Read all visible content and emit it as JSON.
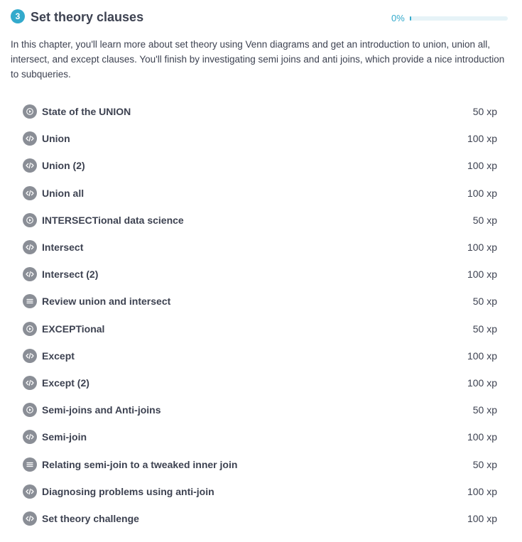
{
  "chapter": {
    "number": "3",
    "title": "Set theory clauses",
    "progress_label": "0%",
    "progress_value": 0,
    "accent_color": "#33aacc",
    "description": "In this chapter, you'll learn more about set theory using Venn diagrams and get an introduction to union, union all, intersect, and except clauses. You'll finish by investigating semi joins and anti joins, which provide a nice introduction to subqueries."
  },
  "lessons": [
    {
      "icon": "play-icon",
      "title": "State of the UNION",
      "xp": "50 xp"
    },
    {
      "icon": "code-icon",
      "title": "Union",
      "xp": "100 xp"
    },
    {
      "icon": "code-icon",
      "title": "Union (2)",
      "xp": "100 xp"
    },
    {
      "icon": "code-icon",
      "title": "Union all",
      "xp": "100 xp"
    },
    {
      "icon": "play-icon",
      "title": "INTERSECTional data science",
      "xp": "50 xp"
    },
    {
      "icon": "code-icon",
      "title": "Intersect",
      "xp": "100 xp"
    },
    {
      "icon": "code-icon",
      "title": "Intersect (2)",
      "xp": "100 xp"
    },
    {
      "icon": "list-icon",
      "title": "Review union and intersect",
      "xp": "50 xp"
    },
    {
      "icon": "play-icon",
      "title": "EXCEPTional",
      "xp": "50 xp"
    },
    {
      "icon": "code-icon",
      "title": "Except",
      "xp": "100 xp"
    },
    {
      "icon": "code-icon",
      "title": "Except (2)",
      "xp": "100 xp"
    },
    {
      "icon": "play-icon",
      "title": "Semi-joins and Anti-joins",
      "xp": "50 xp"
    },
    {
      "icon": "code-icon",
      "title": "Semi-join",
      "xp": "100 xp"
    },
    {
      "icon": "list-icon",
      "title": "Relating semi-join to a tweaked inner join",
      "xp": "50 xp"
    },
    {
      "icon": "code-icon",
      "title": "Diagnosing problems using anti-join",
      "xp": "100 xp"
    },
    {
      "icon": "code-icon",
      "title": "Set theory challenge",
      "xp": "100 xp"
    }
  ]
}
